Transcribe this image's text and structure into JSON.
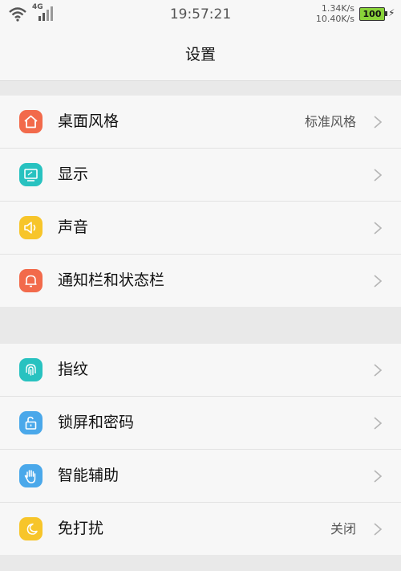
{
  "status_bar": {
    "network": "4G",
    "time": "19:57:21",
    "upload_speed": "1.34K/s",
    "download_speed": "10.40K/s",
    "battery": "100"
  },
  "header": {
    "title": "设置"
  },
  "groups": [
    {
      "items": [
        {
          "label": "桌面风格",
          "value": "标准风格",
          "icon": "home-icon",
          "color": "#f26a4b"
        },
        {
          "label": "显示",
          "value": "",
          "icon": "display-icon",
          "color": "#28c2c0"
        },
        {
          "label": "声音",
          "value": "",
          "icon": "speaker-icon",
          "color": "#f7c52a"
        },
        {
          "label": "通知栏和状态栏",
          "value": "",
          "icon": "bell-icon",
          "color": "#f26a4b"
        }
      ]
    },
    {
      "items": [
        {
          "label": "指纹",
          "value": "",
          "icon": "fingerprint-icon",
          "color": "#28c2c0"
        },
        {
          "label": "锁屏和密码",
          "value": "",
          "icon": "unlock-icon",
          "color": "#4aa8ea"
        },
        {
          "label": "智能辅助",
          "value": "",
          "icon": "hand-icon",
          "color": "#4aa8ea"
        },
        {
          "label": "免打扰",
          "value": "关闭",
          "icon": "moon-icon",
          "color": "#f7c52a"
        }
      ]
    }
  ]
}
